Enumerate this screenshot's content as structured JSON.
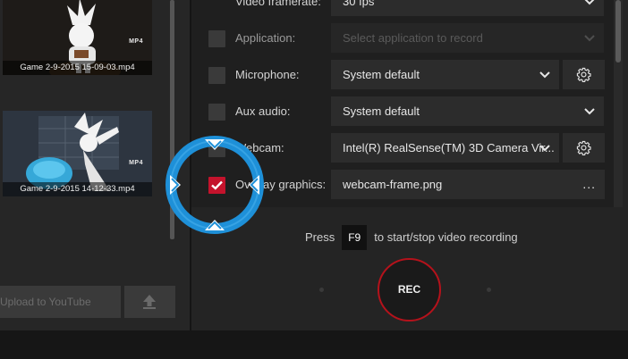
{
  "library": {
    "items": [
      {
        "caption": "Game 2-9-2015 15-09-03.mp4",
        "badge": "MP4"
      },
      {
        "caption": "Game 2-9-2015 14-12-33.mp4",
        "badge": "MP4"
      }
    ],
    "upload_label": "Upload to YouTube"
  },
  "settings": {
    "rows": [
      {
        "label": "Video framerate:",
        "value": ""
      },
      {
        "label": "Application:",
        "value": "Select application to record",
        "enabled": false
      },
      {
        "label": "Microphone:",
        "value": "System default"
      },
      {
        "label": "Aux audio:",
        "value": "System default"
      },
      {
        "label": "Webcam:",
        "value": "Intel(R) RealSense(TM) 3D Camera Vir..."
      },
      {
        "label": "Overlay graphics:",
        "value": "webcam-frame.png",
        "checked": true
      }
    ],
    "framerate_value": "30 fps",
    "browse_label": "..."
  },
  "record": {
    "hint_prefix": "Press",
    "hotkey": "F9",
    "hint_suffix": "to start/stop video recording",
    "rec_label": "REC"
  },
  "colors": {
    "accent_red": "#c4132c",
    "rec_ring": "#b5121b",
    "rotate_overlay": "#1e90d8"
  },
  "icons": {
    "gear": "gear-icon",
    "chevron": "chevron-down-icon",
    "upload": "upload-arrow-icon",
    "check": "check-icon",
    "rotate_overlay": "rotate-cursor-icon"
  }
}
